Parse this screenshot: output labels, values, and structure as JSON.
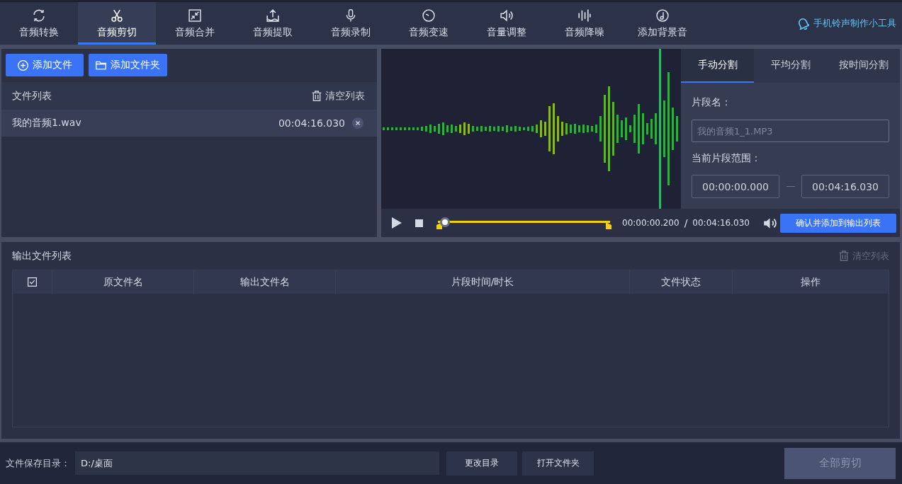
{
  "nav": {
    "tabs": [
      {
        "label": "音频转换",
        "selected": false
      },
      {
        "label": "音频剪切",
        "selected": true
      },
      {
        "label": "音频合并",
        "selected": false
      },
      {
        "label": "音频提取",
        "selected": false
      },
      {
        "label": "音频录制",
        "selected": false
      },
      {
        "label": "音频变速",
        "selected": false
      },
      {
        "label": "音量调整",
        "selected": false
      },
      {
        "label": "音频降噪",
        "selected": false
      },
      {
        "label": "添加背景音",
        "selected": false
      }
    ],
    "tool_link": "手机铃声制作小工具"
  },
  "file_panel": {
    "buttons": [
      "添加文件",
      "添加文件夹"
    ],
    "list_title": "文件列表",
    "clear_button": {
      "label": "清空列表",
      "disabled": false
    },
    "files": [
      {
        "name": "我的音频1.wav",
        "duration": "00:04:16.030",
        "selected": true
      }
    ]
  },
  "editor": {
    "split_tabs": [
      {
        "label": "手动分割",
        "selected": true
      },
      {
        "label": "平均分割",
        "selected": false
      },
      {
        "label": "按时间分割",
        "selected": false
      }
    ],
    "segment_name_label": "片段名：",
    "segment_name": {
      "placeholder": "我的音频1_1.MP3"
    },
    "range_label": "当前片段范围：",
    "range_start": "00:00:00.000",
    "range_end": "00:04:16.030",
    "player": {
      "position": {
        "level": 0.01
      },
      "current_time": "00:00:00.200",
      "time_separator": "/",
      "total_time": "00:04:16.030"
    },
    "confirm_button": "确认并添加到输出列表"
  },
  "output": {
    "title": "输出文件列表",
    "clear_button": {
      "label": "清空列表",
      "disabled": true
    },
    "table": {
      "select_all": {
        "checked": true
      },
      "columns": [
        "原文件名",
        "输出文件名",
        "片段时间/时长",
        "文件状态",
        "操作"
      ]
    }
  },
  "footer": {
    "save_dir_label": "文件保存目录：",
    "save_dir": {
      "value": "D:/桌面"
    },
    "buttons": [
      "更改目录",
      "打开文件夹"
    ],
    "cut_all_button": {
      "label": "全部剪切",
      "disabled": true
    }
  }
}
